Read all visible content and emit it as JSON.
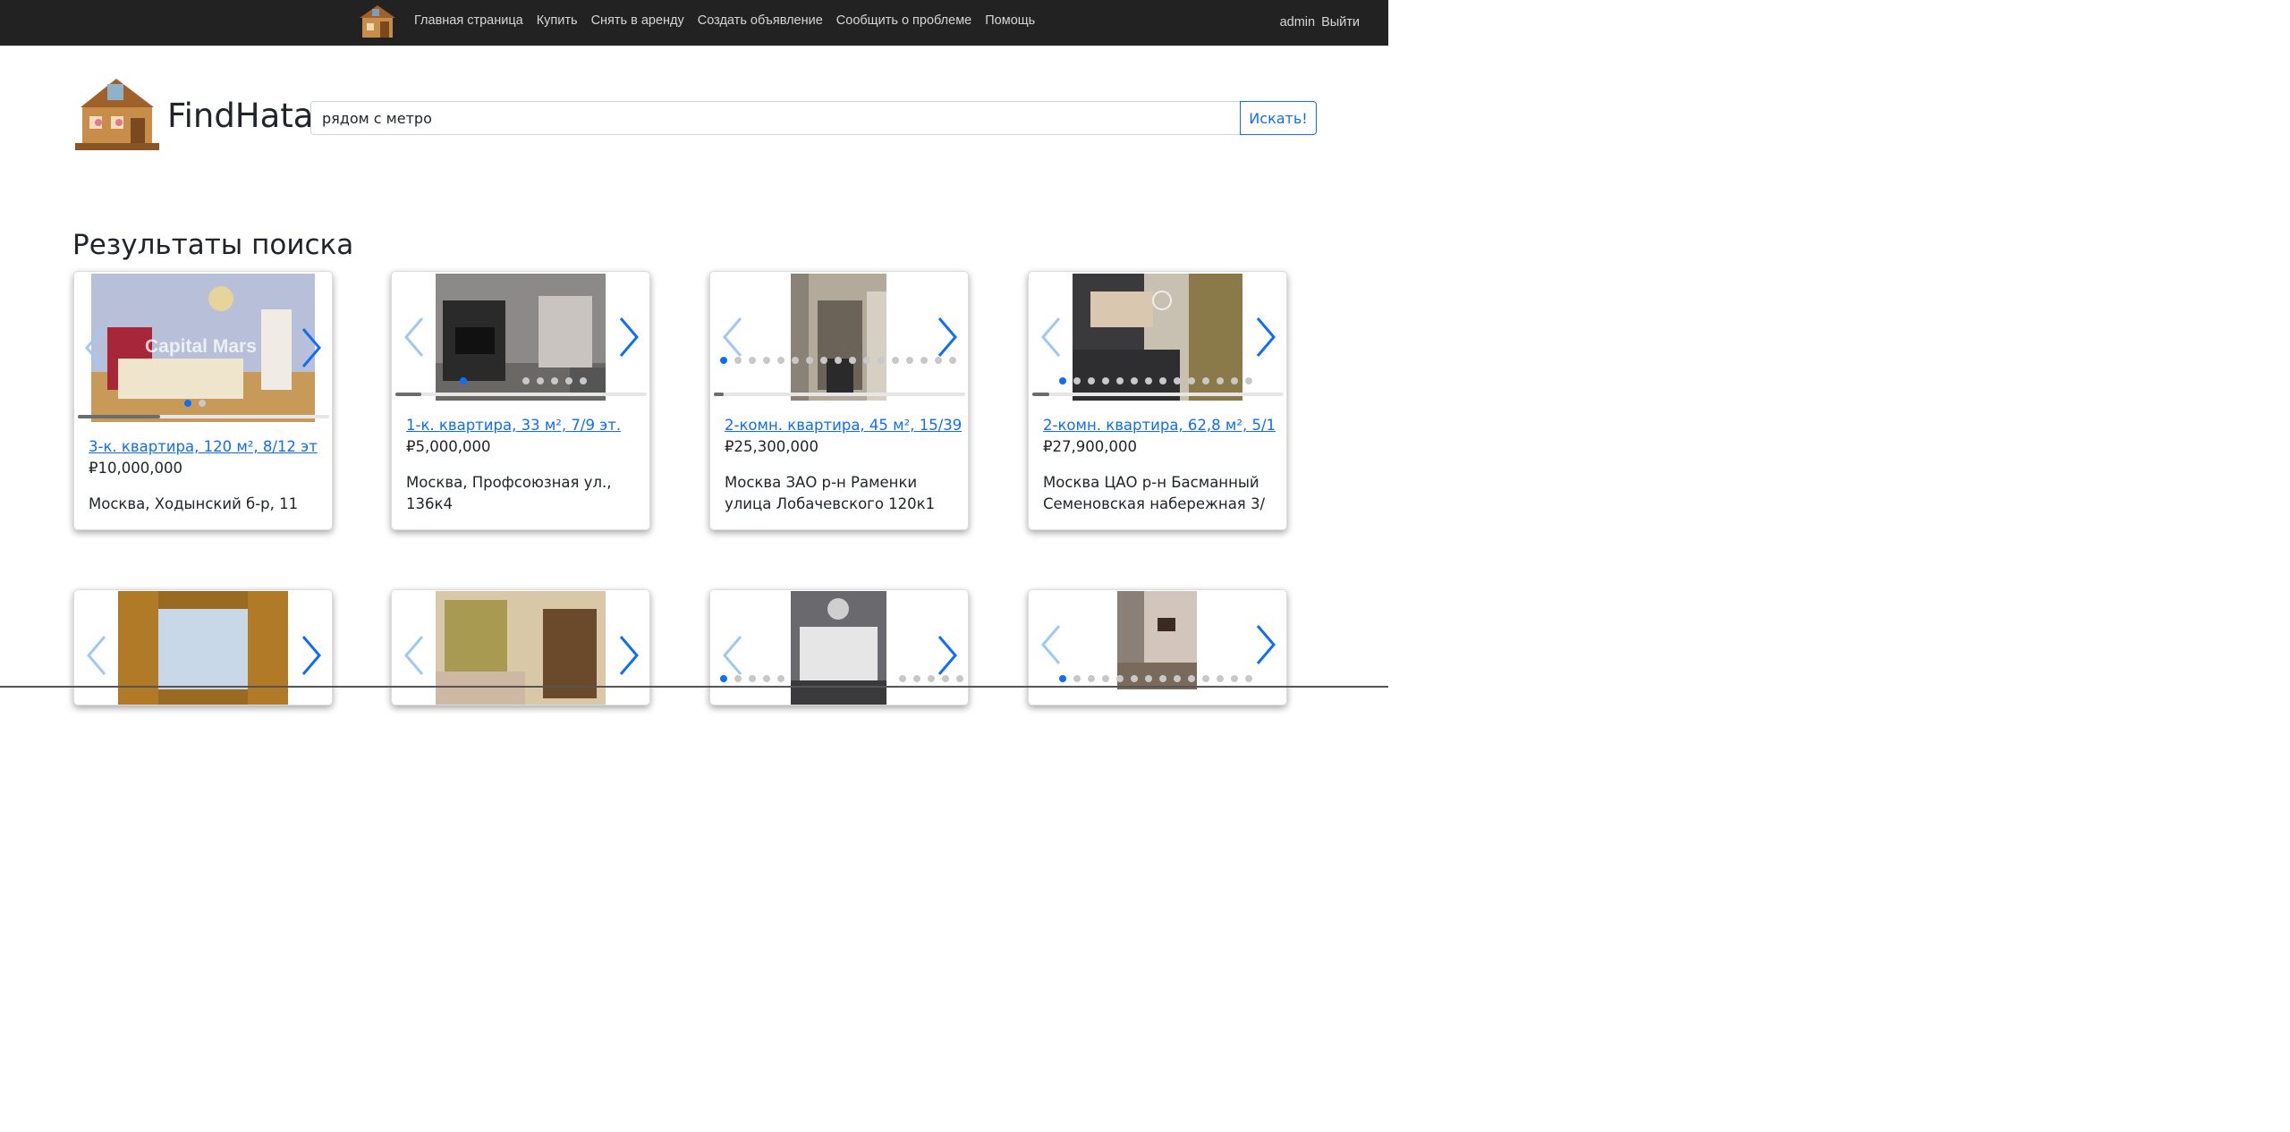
{
  "nav": {
    "logo_icon": "house-logo-icon",
    "links": [
      "Главная страница",
      "Купить",
      "Снять в аренду",
      "Создать объявление",
      "Сообщить о проблеме",
      "Помощь"
    ],
    "user": "admin",
    "logout": "Выйти"
  },
  "header": {
    "brand": "FindHata",
    "search_value": "рядом с метро",
    "search_button": "Искать!"
  },
  "results": {
    "title": "Результаты поиска",
    "cards": [
      {
        "title": "3-к. квартира, 120 м², 8/12 эт",
        "price": "₽10,000,000",
        "address": "Москва, Ходынский б-р, 11",
        "watermark": "Capital Mars",
        "active_photo": 1,
        "photo_count": 2,
        "scroll_progress": 0.33
      },
      {
        "title": "1-к. квартира, 33 м², 7/9 эт.",
        "price": "₽5,000,000",
        "address": "Москва, Профсоюзная ул., 136к4",
        "active_photo": 1,
        "photo_count": 6,
        "scroll_progress": 0.1
      },
      {
        "title": "2-комн. квартира, 45 м², 15/39",
        "price": "₽25,300,000",
        "address": "Москва ЗАО р-н Раменки улица Лобачевского 120к1",
        "active_photo": 1,
        "photo_count": 17,
        "scroll_progress": 0.04
      },
      {
        "title": "2-комн. квартира, 62,8 м², 5/1",
        "price": "₽27,900,000",
        "address": "Москва ЦАО р-н Басманный Семеновская набережная 3/",
        "active_photo": 1,
        "photo_count": 14,
        "scroll_progress": 0.07
      }
    ]
  },
  "colors": {
    "accent": "#0d6efd",
    "navbar": "#222222"
  }
}
